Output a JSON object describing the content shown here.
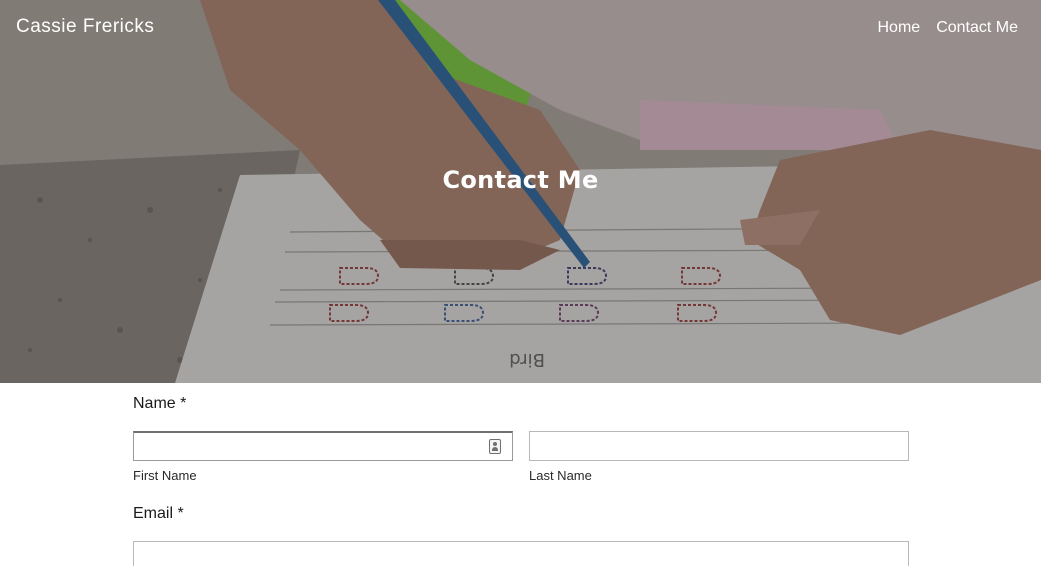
{
  "header": {
    "site_title": "Cassie Frericks",
    "nav": [
      {
        "label": "Home"
      },
      {
        "label": "Contact Me"
      }
    ]
  },
  "hero": {
    "heading": "Contact Me",
    "image_icon": "child-tracing-letters-photo"
  },
  "form": {
    "name": {
      "label": "Name *",
      "first": {
        "value": "",
        "placeholder": "",
        "sublabel": "First Name",
        "icon": "contact-card-icon"
      },
      "last": {
        "value": "",
        "placeholder": "",
        "sublabel": "Last Name"
      }
    },
    "email": {
      "label": "Email *",
      "value": "",
      "placeholder": ""
    }
  },
  "colors": {
    "hero_text": "#ffffff",
    "input_border": "#b8b8b8",
    "label_text": "#1a1a1a"
  }
}
